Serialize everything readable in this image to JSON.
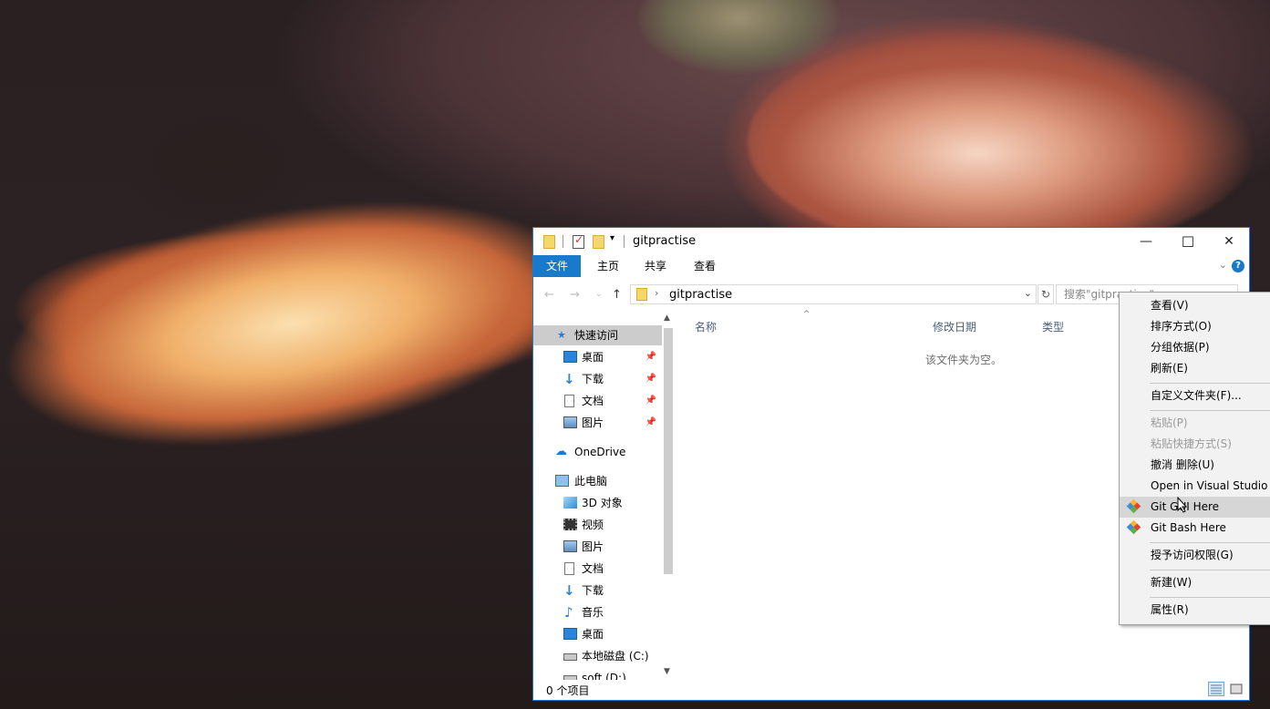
{
  "window": {
    "title": "gitpractise",
    "controls": {
      "minimize": "—",
      "maximize": "☐",
      "close": "✕"
    }
  },
  "ribbon": {
    "tabs": [
      "文件",
      "主页",
      "共享",
      "查看"
    ],
    "active_tab": "文件",
    "help": "?"
  },
  "address": {
    "path": "gitpractise",
    "search_placeholder": "搜索\"gitpractise\""
  },
  "nav": {
    "quick_access": "快速访问",
    "pinned": [
      "桌面",
      "下载",
      "文档",
      "图片"
    ],
    "onedrive": "OneDrive",
    "this_pc": "此电脑",
    "pc_items": [
      "3D 对象",
      "视频",
      "图片",
      "文档",
      "下载",
      "音乐",
      "桌面",
      "本地磁盘 (C:)",
      "soft (D:)"
    ]
  },
  "columns": {
    "name": "名称",
    "modified": "修改日期",
    "type": "类型"
  },
  "empty_message": "该文件夹为空。",
  "status": {
    "item_count": "0 个项目"
  },
  "context_menu": {
    "items": [
      {
        "label": "查看(V)",
        "disabled": false
      },
      {
        "label": "排序方式(O)",
        "disabled": false
      },
      {
        "label": "分组依据(P)",
        "disabled": false
      },
      {
        "label": "刷新(E)",
        "disabled": false
      },
      {
        "label": "自定义文件夹(F)...",
        "disabled": false
      },
      {
        "label": "粘贴(P)",
        "disabled": true
      },
      {
        "label": "粘贴快捷方式(S)",
        "disabled": true
      },
      {
        "label": "撤消 删除(U)",
        "disabled": false
      },
      {
        "label": "Open in Visual Studio",
        "disabled": false
      },
      {
        "label": "Git GUI Here",
        "disabled": false,
        "icon": "git-icon",
        "hovered": true
      },
      {
        "label": "Git Bash Here",
        "disabled": false,
        "icon": "git-icon"
      },
      {
        "label": "授予访问权限(G)",
        "disabled": false
      },
      {
        "label": "新建(W)",
        "disabled": false
      },
      {
        "label": "属性(R)",
        "disabled": false
      }
    ]
  },
  "colors": {
    "accent": "#1979ca",
    "window_border": "#1a7ad4",
    "menu_bg": "#f2f2f2"
  }
}
